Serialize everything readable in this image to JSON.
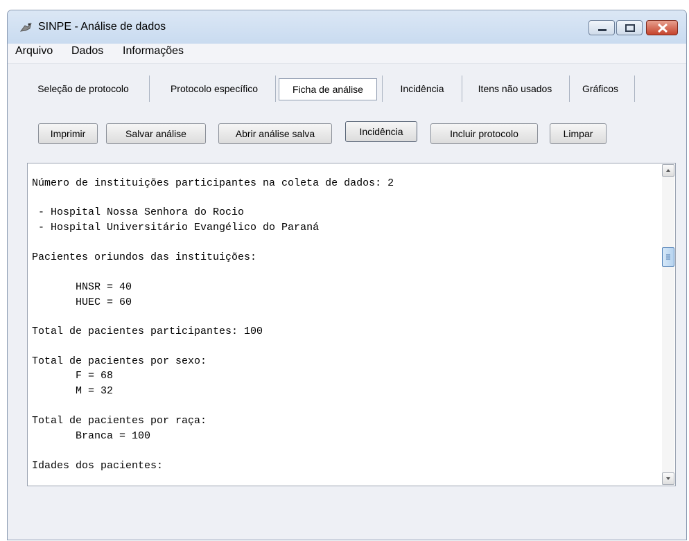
{
  "window": {
    "title": "SINPE - Análise de dados",
    "icon": "app-bird-icon"
  },
  "menu": [
    "Arquivo",
    "Dados",
    "Informações"
  ],
  "tabs": [
    {
      "label": "Seleção de protocolo",
      "active": false
    },
    {
      "label": "Protocolo específico",
      "active": false
    },
    {
      "label": "Ficha de análise",
      "active": true
    },
    {
      "label": "Incidência",
      "active": false
    },
    {
      "label": "Itens não usados",
      "active": false
    },
    {
      "label": "Gráficos",
      "active": false
    }
  ],
  "toolbar": {
    "imprimir": "Imprimir",
    "salvar": "Salvar análise",
    "abrir": "Abrir análise salva",
    "incidencia": "Incidência",
    "incluir": "Incluir protocolo",
    "limpar": "Limpar"
  },
  "report": {
    "lines": [
      "Número de instituições participantes na coleta de dados: 2",
      " - Hospital Nossa Senhora do Rocio",
      " - Hospital Universitário Evangélico do Paraná",
      "Pacientes oriundos das instituições:",
      "       HNSR = 40",
      "       HUEC = 60",
      "Total de pacientes participantes: 100",
      "Total de pacientes por sexo:",
      "       F = 68",
      "       M = 32",
      "Total de pacientes por raça:",
      "       Branca = 100",
      "Idades dos pacientes:"
    ]
  }
}
